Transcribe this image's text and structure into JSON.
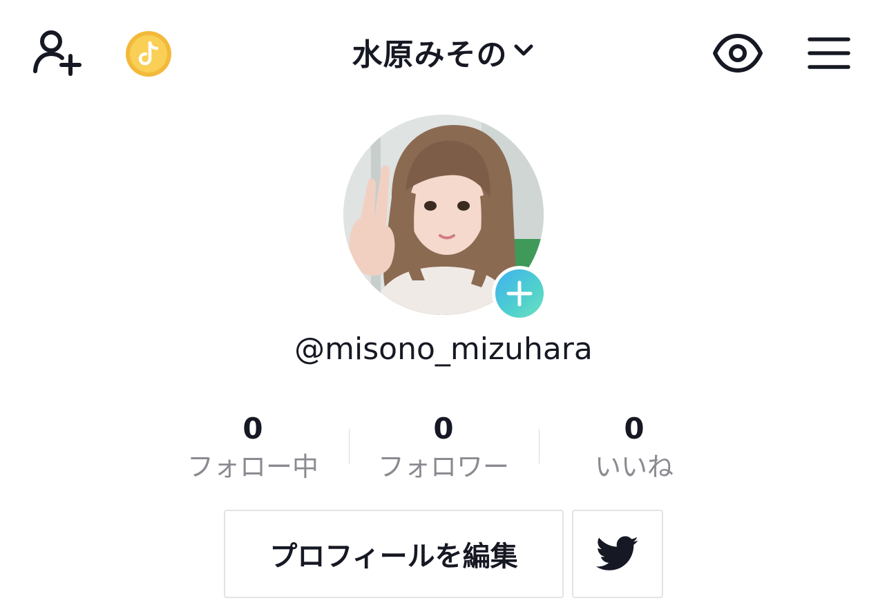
{
  "header": {
    "title": "水原みその",
    "icons": {
      "add_friend": "add-friend-icon",
      "coin": "tiktok-coin-icon",
      "profile_views": "eye-icon",
      "menu": "hamburger-menu-icon",
      "dropdown": "chevron-down-icon"
    }
  },
  "profile": {
    "username": "@misono_mizuhara",
    "avatar_badge": "plus-icon"
  },
  "stats": [
    {
      "value": "0",
      "label": "フォロー中"
    },
    {
      "value": "0",
      "label": "フォロワー"
    },
    {
      "value": "0",
      "label": "いいね"
    }
  ],
  "actions": {
    "edit_profile_label": "プロフィールを編集",
    "twitter_icon": "twitter-bird-icon"
  },
  "colors": {
    "text_primary": "#161823",
    "text_secondary": "#8a8b91",
    "coin": "#f6c343",
    "badge_gradient_start": "#3fb1f1",
    "badge_gradient_end": "#6fe0c0"
  }
}
